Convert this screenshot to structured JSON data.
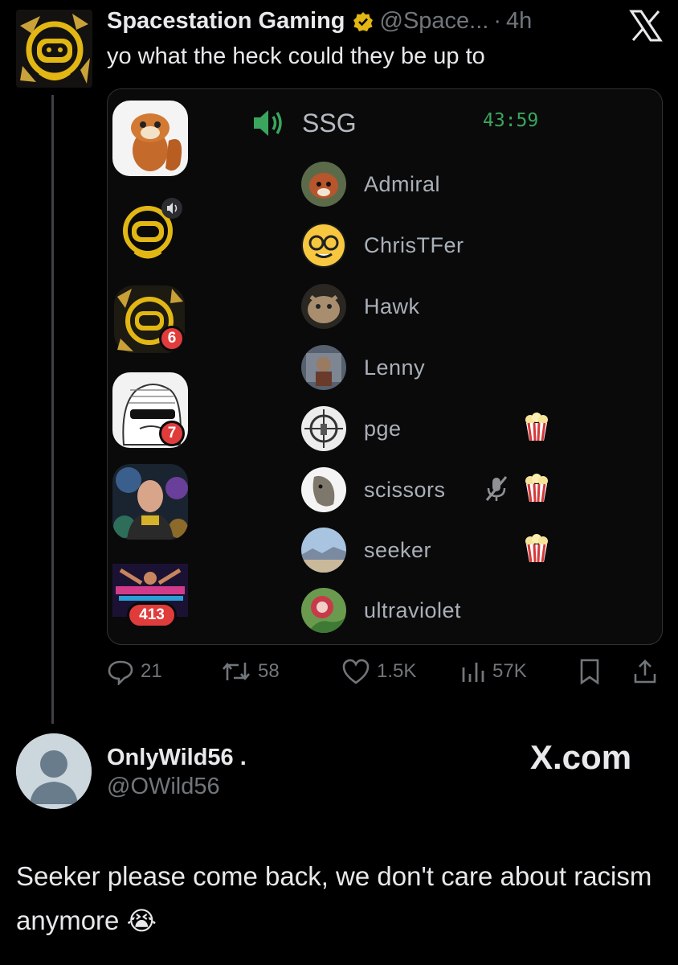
{
  "tweet": {
    "author_name": "Spacestation Gaming",
    "handle": "@Space...",
    "separator": "·",
    "time": "4h",
    "text": "yo what the heck could they be up to",
    "verified_color": "#e2b714"
  },
  "discord": {
    "channel_name": "SSG",
    "timer": "43:59",
    "server_badges": [
      "6",
      "7",
      "413"
    ],
    "members": [
      {
        "name": "Admiral",
        "muted": false,
        "popcorn": false
      },
      {
        "name": "ChrisTFer",
        "muted": false,
        "popcorn": false
      },
      {
        "name": "Hawk",
        "muted": false,
        "popcorn": false
      },
      {
        "name": "Lenny",
        "muted": false,
        "popcorn": false
      },
      {
        "name": "pge",
        "muted": false,
        "popcorn": true
      },
      {
        "name": "scissors",
        "muted": true,
        "popcorn": true
      },
      {
        "name": "seeker",
        "muted": false,
        "popcorn": true
      },
      {
        "name": "ultraviolet",
        "muted": false,
        "popcorn": false
      }
    ],
    "accent_green": "#3ba55d",
    "badge_red": "#e03c3c"
  },
  "actions": {
    "replies": "21",
    "reposts": "58",
    "likes": "1.5K",
    "views": "57K"
  },
  "reply": {
    "author_name": "OnlyWild56 .",
    "handle": "@OWild56",
    "watermark": "X.com",
    "text": "Seeker please come back, we don't care about racism anymore",
    "emoji": "😭"
  }
}
